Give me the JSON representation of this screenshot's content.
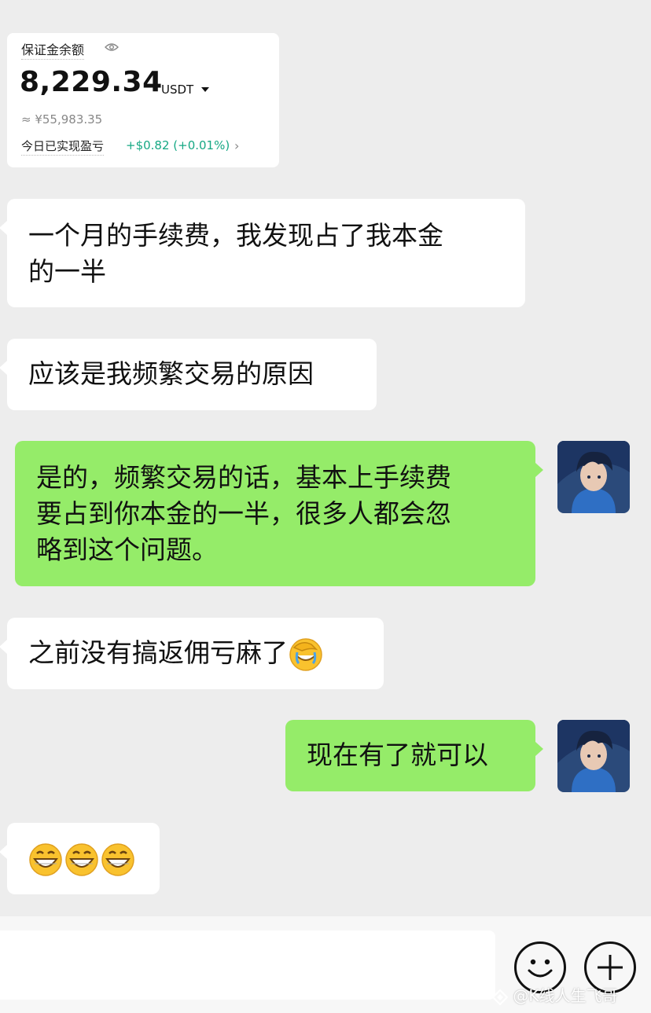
{
  "balance_card": {
    "label": "保证金余额",
    "amount": "8,229.34",
    "unit": "USDT",
    "approx_value": "≈ ¥55,983.35",
    "pnl_label": "今日已实现盈亏",
    "pnl_value": "+$0.82 (+0.01%)"
  },
  "messages": [
    {
      "side": "left",
      "lines": [
        "一个月的手续费，我发现占了我本金",
        "的一半"
      ]
    },
    {
      "side": "left",
      "lines": [
        "应该是我频繁交易的原因"
      ]
    },
    {
      "side": "right",
      "lines": [
        "是的，频繁交易的话，基本上手续费",
        "要占到你本金的一半，很多人都会忽",
        "略到这个问题。"
      ]
    },
    {
      "side": "left",
      "lines": [
        "之前没有搞返佣亏麻了"
      ],
      "emoji": "facepalm-laugh-emoji"
    },
    {
      "side": "right",
      "lines": [
        "现在有了就可以"
      ]
    },
    {
      "side": "left",
      "emojis": [
        "grin-emoji",
        "grin-emoji",
        "grin-emoji"
      ]
    }
  ],
  "input_bar": {
    "emoji_button": "smiley-icon",
    "plus_button": "plus-icon"
  },
  "watermark": "@K线人生飞哥",
  "colors": {
    "background": "#ededed",
    "self_bubble": "#95ec69",
    "other_bubble": "#ffffff",
    "pnl_positive": "#16a884"
  }
}
